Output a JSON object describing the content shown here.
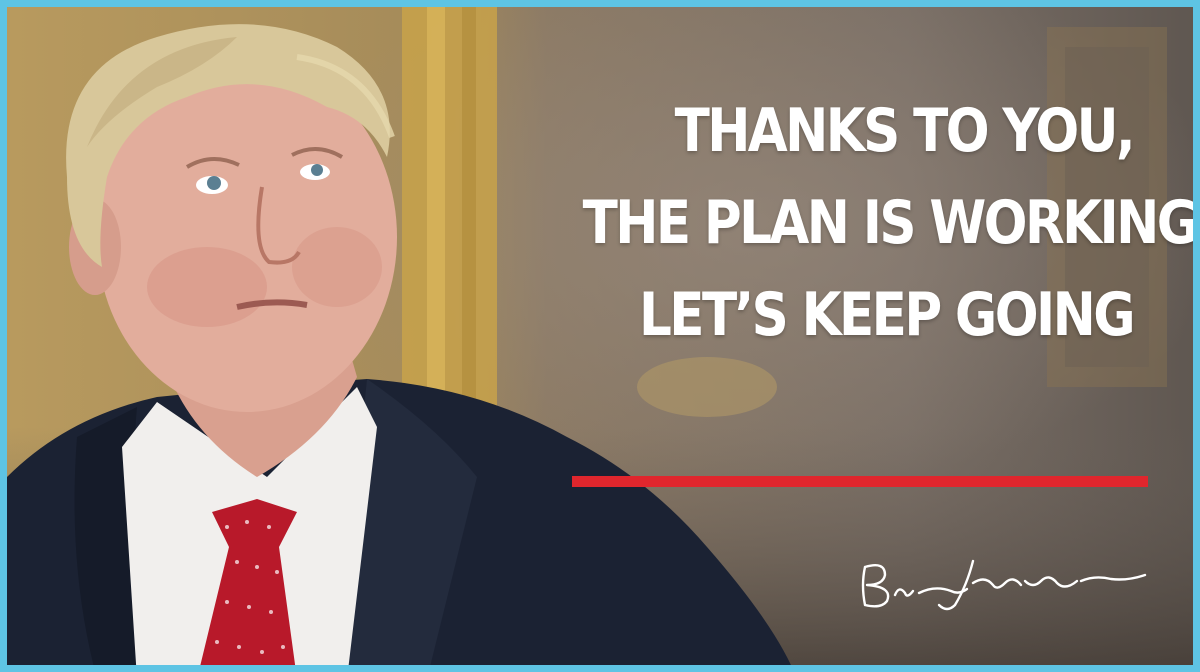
{
  "headline": {
    "line1": "THANKS TO YOU,",
    "line2": "THE PLAN IS WORKING.",
    "line3": "LET’S KEEP GOING"
  },
  "signature": {
    "text": "Boris Johnson"
  },
  "colors": {
    "border": "#5ec4e4",
    "accent_rule": "#e0262d",
    "headline_text": "#ffffff"
  }
}
